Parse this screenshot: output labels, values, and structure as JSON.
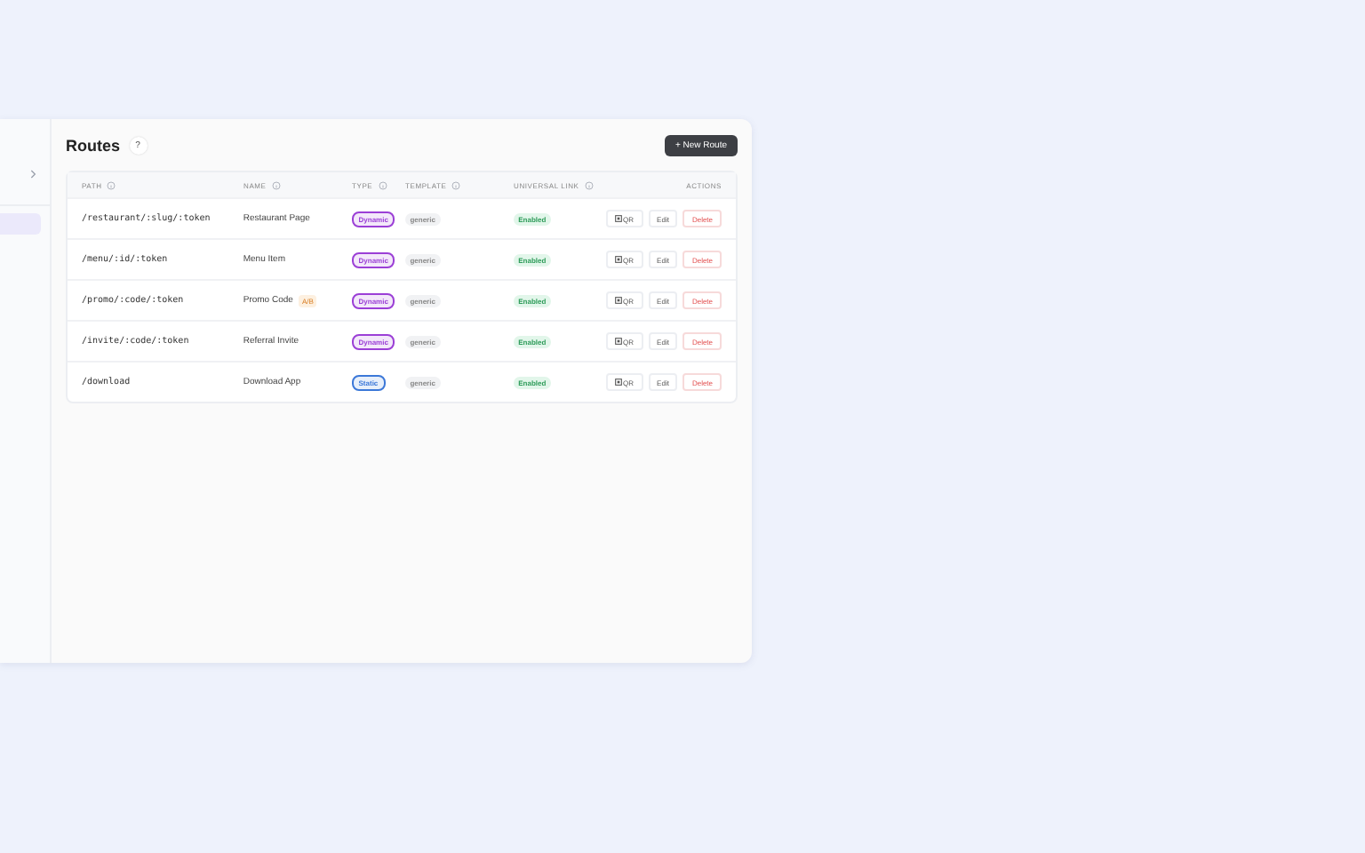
{
  "sidebar": {
    "items": [
      {
        "selected": true
      }
    ]
  },
  "page": {
    "title": "Routes",
    "help": "?",
    "new_button": "New Route",
    "new_icon": "+"
  },
  "table": {
    "columns": [
      {
        "label": "PATH",
        "info": true
      },
      {
        "label": "NAME",
        "info": true
      },
      {
        "label": "TYPE",
        "info": true
      },
      {
        "label": "TEMPLATE",
        "info": true
      },
      {
        "label": "UNIVERSAL LINK",
        "info": true
      },
      {
        "label": "ACTIONS",
        "info": false
      }
    ],
    "rows": [
      {
        "path": "/restaurant/:slug/:token",
        "name": "Restaurant Page",
        "tag": null,
        "type": "Dynamic",
        "color": "#9b3fd6",
        "template": "generic",
        "link": "Enabled",
        "actions": [
          "QR",
          "Edit",
          "Delete"
        ]
      },
      {
        "path": "/menu/:id/:token",
        "name": "Menu Item",
        "tag": null,
        "type": "Dynamic",
        "color": "#9b3fd6",
        "template": "generic",
        "link": "Enabled",
        "actions": [
          "QR",
          "Edit",
          "Delete"
        ]
      },
      {
        "path": "/promo/:code/:token",
        "name": "Promo Code",
        "tag": "A/B",
        "type": "Dynamic",
        "color": "#9b3fd6",
        "template": "generic",
        "link": "Enabled",
        "actions": [
          "QR",
          "Edit",
          "Delete"
        ]
      },
      {
        "path": "/invite/:code/:token",
        "name": "Referral Invite",
        "tag": null,
        "type": "Dynamic",
        "color": "#9b3fd6",
        "template": "generic",
        "link": "Enabled",
        "actions": [
          "QR",
          "Edit",
          "Delete"
        ]
      },
      {
        "path": "/download",
        "name": "Download App",
        "tag": null,
        "type": "Static",
        "color": "#3c78d8",
        "template": "generic",
        "link": "Enabled",
        "actions": [
          "QR",
          "Edit",
          "Delete"
        ]
      }
    ]
  }
}
